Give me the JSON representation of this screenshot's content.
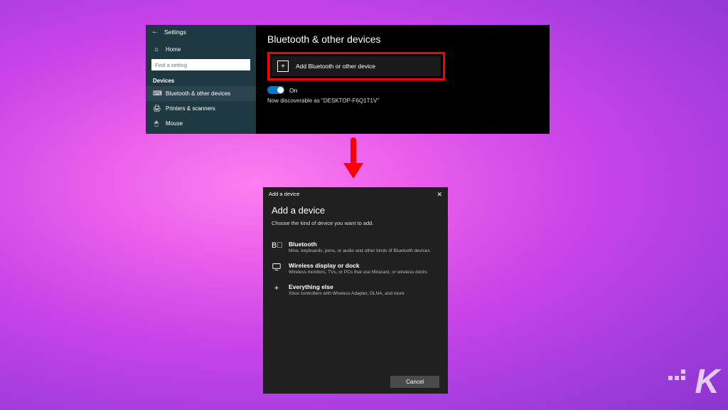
{
  "settings": {
    "titlebar": "Settings",
    "nav_home": "Home",
    "search_placeholder": "Find a setting",
    "section_devices": "Devices",
    "nav_bluetooth": "Bluetooth & other devices",
    "nav_printers": "Printers & scanners",
    "nav_mouse": "Mouse"
  },
  "main": {
    "title": "Bluetooth & other devices",
    "add_device": "Add Bluetooth or other device",
    "toggle_label": "On",
    "discoverable": "Now discoverable as \"DESKTOP-F6Q1T1V\""
  },
  "dialog": {
    "titlebar": "Add a device",
    "heading": "Add a device",
    "subheading": "Choose the kind of device you want to add.",
    "options": [
      {
        "title": "Bluetooth",
        "desc": "Mice, keyboards, pens, or audio and other kinds of Bluetooth devices"
      },
      {
        "title": "Wireless display or dock",
        "desc": "Wireless monitors, TVs, or PCs that use Miracast, or wireless docks"
      },
      {
        "title": "Everything else",
        "desc": "Xbox controllers with Wireless Adapter, DLNA, and more"
      }
    ],
    "cancel": "Cancel"
  }
}
